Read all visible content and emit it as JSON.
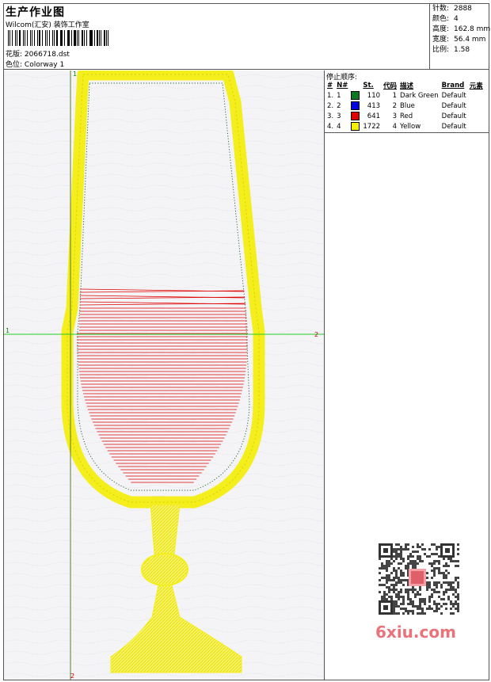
{
  "header": {
    "title": "生产作业图",
    "company": "Wilcom(汇安) 装饰工作室",
    "design_label": "花版:",
    "design_value": "2066718.dst",
    "colorway_label": "色位:",
    "colorway_value": "Colorway 1"
  },
  "stats": [
    {
      "label": "针数:",
      "value": "2888"
    },
    {
      "label": "颜色:",
      "value": "4"
    },
    {
      "label": "高度:",
      "value": "162.8 mm"
    },
    {
      "label": "宽度:",
      "value": "56.4 mm"
    },
    {
      "label": "比例:",
      "value": "1.58"
    }
  ],
  "stop_sequence": {
    "title": "停止顺序:",
    "columns": [
      "#",
      "N#",
      "St.",
      "代码",
      "描述",
      "Brand",
      "元素"
    ],
    "rows": [
      {
        "index": "1.",
        "n": "1",
        "color": "#0a7a1e",
        "stitches": "110",
        "code": "1",
        "desc": "Dark Green",
        "brand": "Default"
      },
      {
        "index": "2.",
        "n": "2",
        "color": "#0000e0",
        "stitches": "413",
        "code": "2",
        "desc": "Blue",
        "brand": "Default"
      },
      {
        "index": "3.",
        "n": "3",
        "color": "#e00000",
        "stitches": "641",
        "code": "3",
        "desc": "Red",
        "brand": "Default"
      },
      {
        "index": "4.",
        "n": "4",
        "color": "#f5ef00",
        "stitches": "1722",
        "code": "4",
        "desc": "Yellow",
        "brand": "Default"
      }
    ]
  },
  "canvas": {
    "marker_v_top": "1",
    "marker_v_bottom": "2",
    "marker_h_left": "1",
    "marker_h_right": "2"
  },
  "watermark": {
    "site": "6xiu.com"
  }
}
